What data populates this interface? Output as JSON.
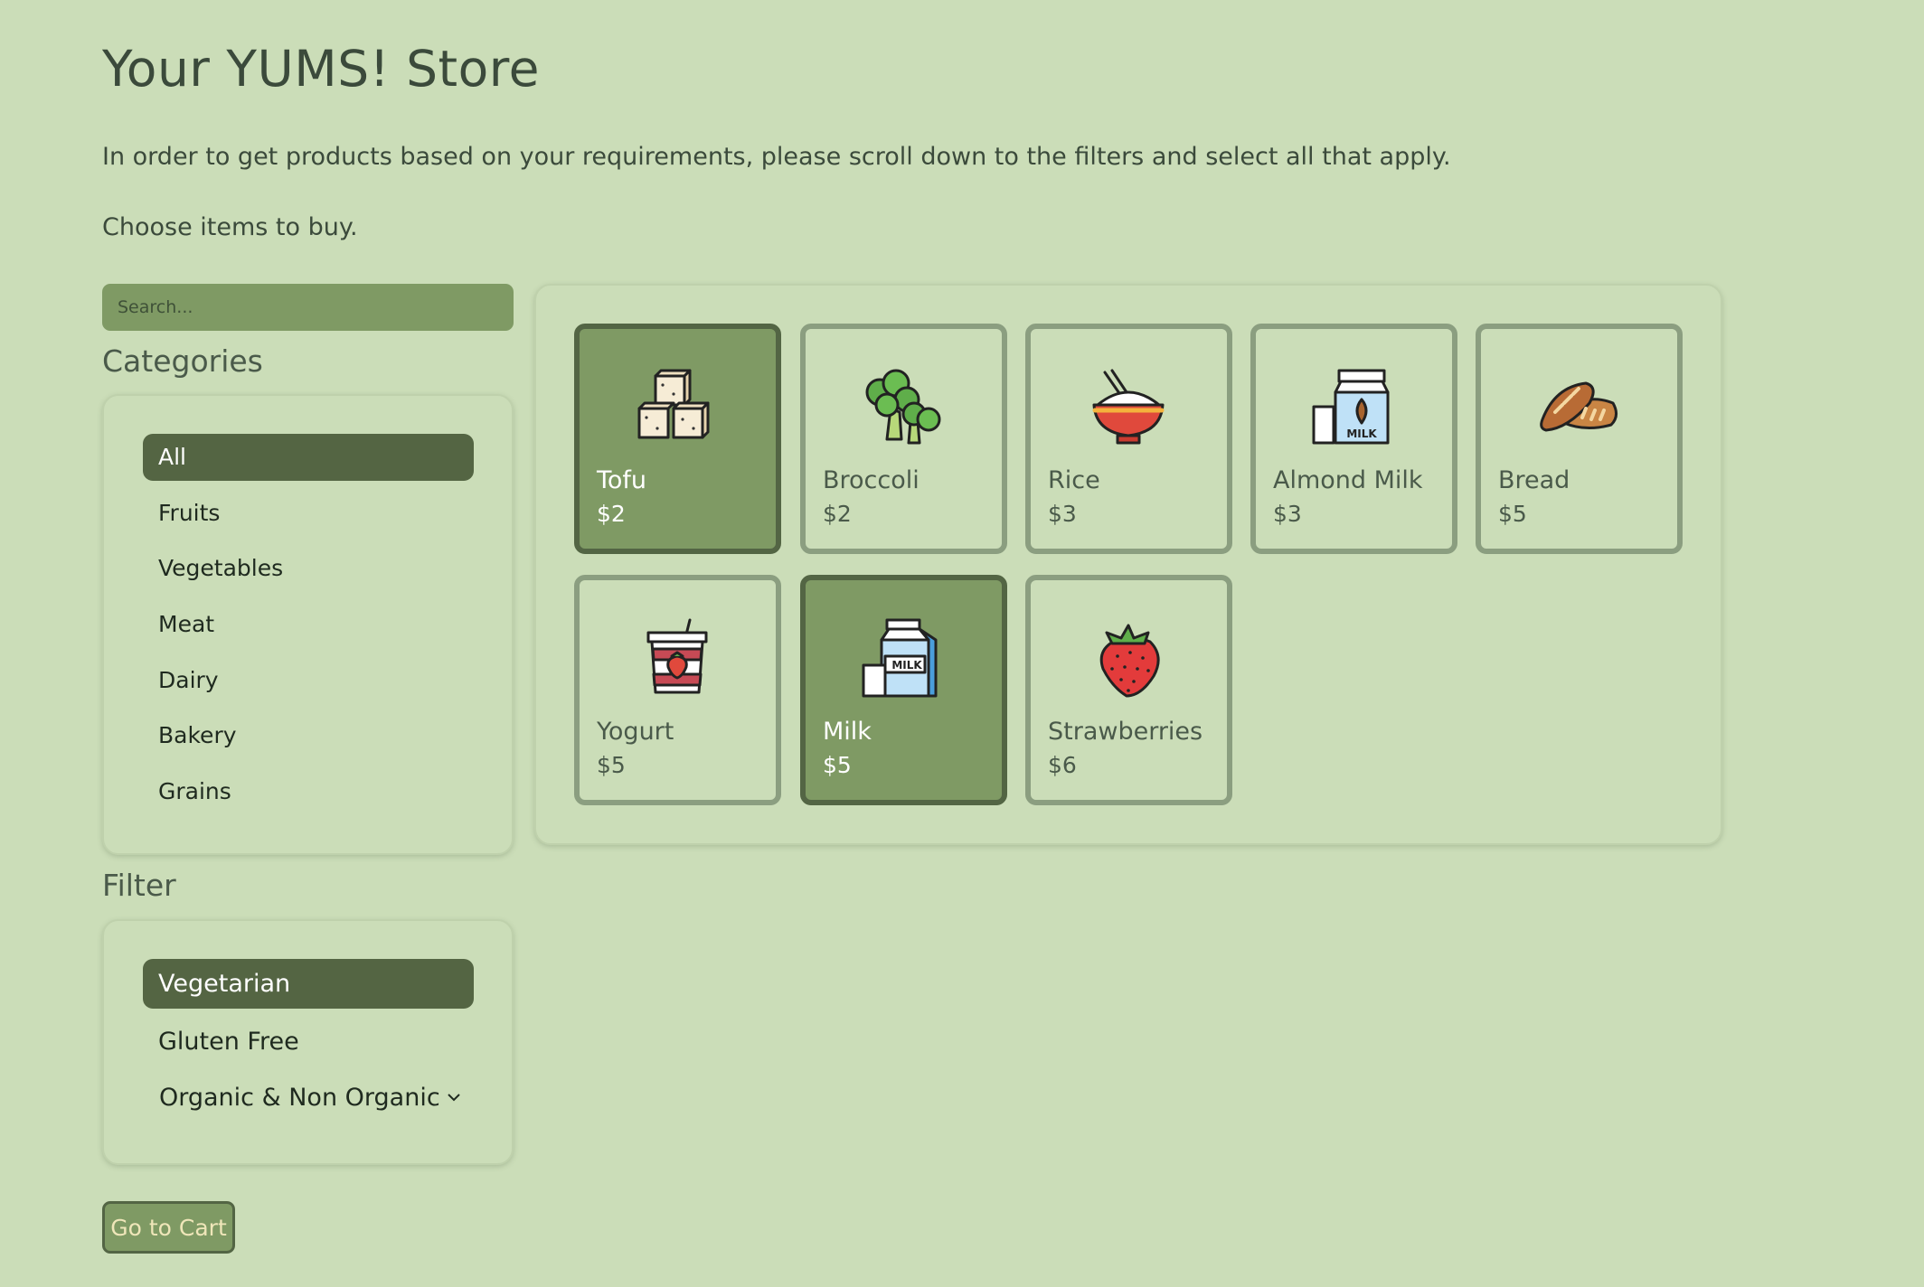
{
  "header": {
    "title": "Your YUMS! Store",
    "intro": "In order to get products based on your requirements, please scroll down to the filters and select all that apply.",
    "choose": "Choose items to buy."
  },
  "search": {
    "placeholder": "Search..."
  },
  "categories": {
    "title": "Categories",
    "items": [
      {
        "label": "All",
        "active": true
      },
      {
        "label": "Fruits"
      },
      {
        "label": "Vegetables"
      },
      {
        "label": "Meat"
      },
      {
        "label": "Dairy"
      },
      {
        "label": "Bakery"
      },
      {
        "label": "Grains"
      }
    ]
  },
  "filter": {
    "title": "Filter",
    "items": [
      {
        "label": "Vegetarian",
        "active": true
      },
      {
        "label": "Gluten Free"
      }
    ],
    "select_value": "Organic & Non Organic"
  },
  "cart": {
    "label": "Go to Cart"
  },
  "products": [
    {
      "name": "Tofu",
      "price": "$2",
      "selected": true,
      "icon": "tofu-icon"
    },
    {
      "name": "Broccoli",
      "price": "$2",
      "icon": "broccoli-icon"
    },
    {
      "name": "Rice",
      "price": "$3",
      "icon": "rice-bowl-icon"
    },
    {
      "name": "Almond Milk",
      "price": "$3",
      "icon": "almond-milk-icon"
    },
    {
      "name": "Bread",
      "price": "$5",
      "icon": "bread-icon"
    },
    {
      "name": "Yogurt",
      "price": "$5",
      "icon": "yogurt-icon"
    },
    {
      "name": "Milk",
      "price": "$5",
      "selected": true,
      "icon": "milk-carton-icon"
    },
    {
      "name": "Strawberries",
      "price": "$6",
      "icon": "strawberry-icon"
    }
  ],
  "colors": {
    "background": "#cbddb8",
    "accent": "#7f9a64",
    "active": "#546543",
    "card_border": "#8b9e80",
    "cart_text": "#efe6b9"
  }
}
